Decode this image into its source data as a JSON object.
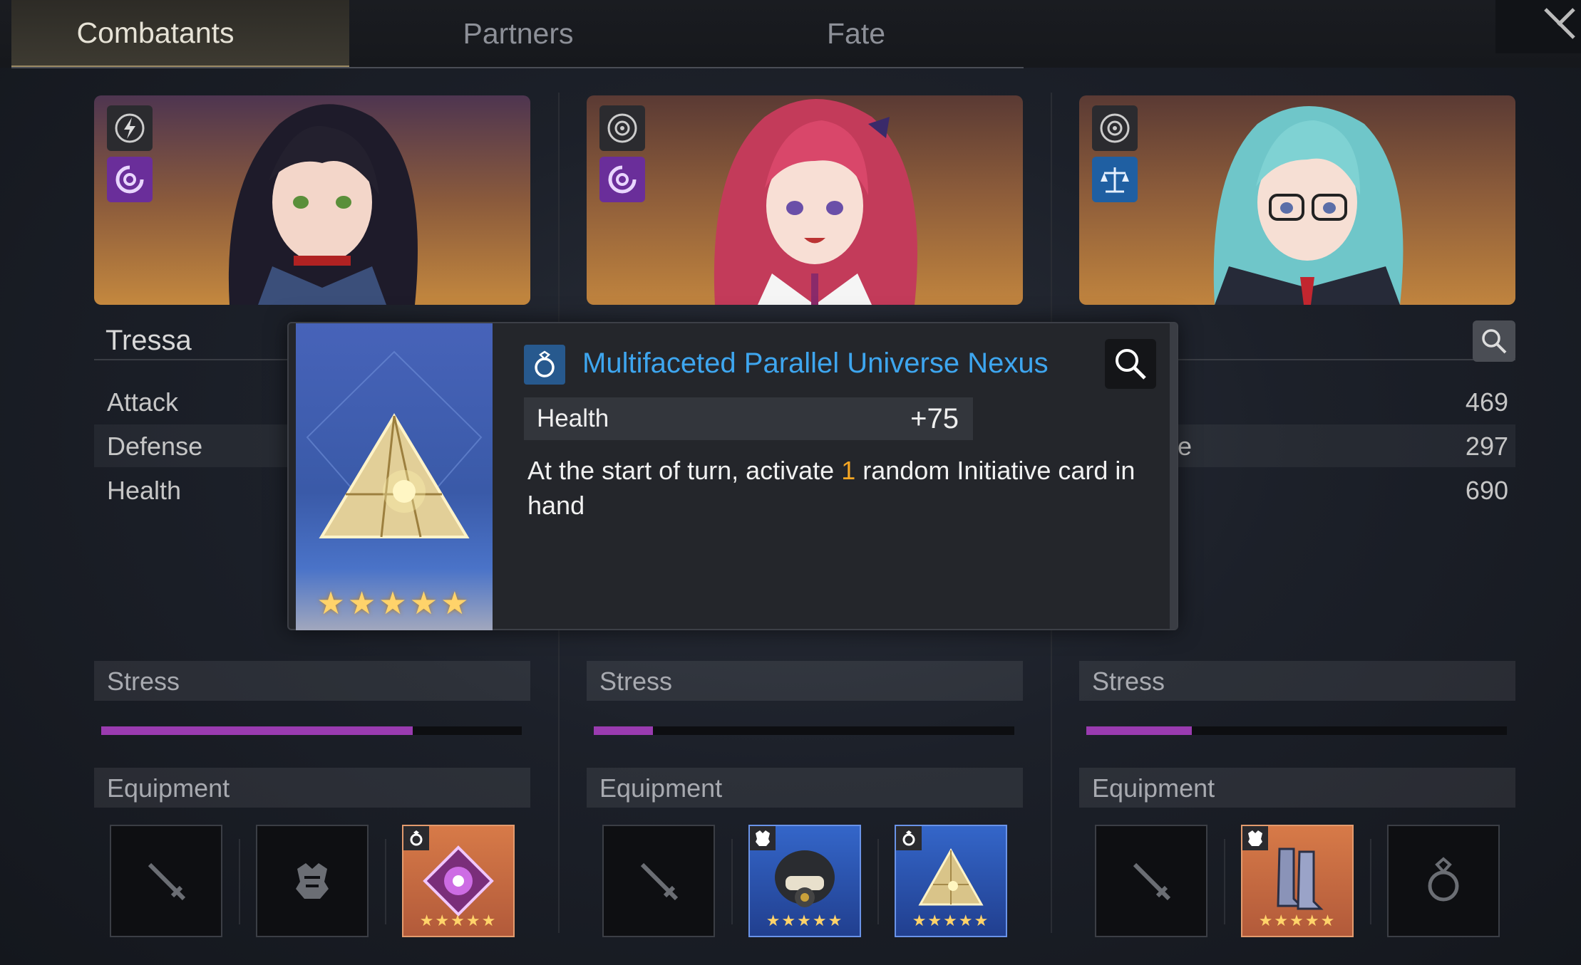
{
  "tabs": [
    {
      "label": "Combatants",
      "active": true
    },
    {
      "label": "Partners",
      "active": false
    },
    {
      "label": "Fate",
      "active": false
    }
  ],
  "characters": [
    {
      "name": "Tressa",
      "badges": [
        "lightning-icon",
        "swirl-icon"
      ],
      "stats": [
        {
          "label": "Attack",
          "value": ""
        },
        {
          "label": "Defense",
          "value": ""
        },
        {
          "label": "Health",
          "value": ""
        }
      ],
      "stress_label": "Stress",
      "stress_level": 0.74,
      "equipment_label": "Equipment",
      "equipment": [
        {
          "type": "weapon",
          "icon": "sword-icon",
          "filled": false
        },
        {
          "type": "armor",
          "icon": "armor-icon",
          "filled": false
        },
        {
          "type": "ring",
          "icon": "purple-crystal-item",
          "filled": true,
          "rarity": "★★★★★"
        }
      ]
    },
    {
      "name": "",
      "badges": [
        "target-icon",
        "swirl-icon"
      ],
      "stats": [
        {
          "label": "",
          "value": ""
        },
        {
          "label": "",
          "value": ""
        },
        {
          "label": "",
          "value": ""
        }
      ],
      "stress_label": "Stress",
      "stress_level": 0.14,
      "equipment_label": "Equipment",
      "equipment": [
        {
          "type": "weapon",
          "icon": "sword-icon",
          "filled": false
        },
        {
          "type": "armor",
          "icon": "gas-mask-helmet-item",
          "filled": true,
          "rarity": "★★★★★"
        },
        {
          "type": "ring",
          "icon": "pyramid-item",
          "filled": true,
          "rarity": "★★★★★"
        }
      ]
    },
    {
      "name": "",
      "badges": [
        "target-icon",
        "scales-icon"
      ],
      "stats": [
        {
          "label": "",
          "value": "469"
        },
        {
          "label": "se",
          "value": "297"
        },
        {
          "label": "",
          "value": "690"
        }
      ],
      "stress_label": "Stress",
      "stress_level": 0.25,
      "equipment_label": "Equipment",
      "equipment": [
        {
          "type": "weapon",
          "icon": "sword-icon",
          "filled": false
        },
        {
          "type": "armor",
          "icon": "boots-item",
          "filled": true,
          "rarity": "★★★★★"
        },
        {
          "type": "ring",
          "icon": "ring-icon",
          "filled": false
        }
      ]
    }
  ],
  "tooltip": {
    "title": "Multifaceted Parallel Universe Nexus",
    "type_icon": "ring-icon",
    "rarity": "★★★★★",
    "stat_label": "Health",
    "stat_value": "+75",
    "desc_before": "At the start of turn, activate ",
    "desc_highlight": "1",
    "desc_after": " random Initiative card in hand"
  },
  "colors": {
    "accent_title": "#3ea6ef",
    "highlight": "#f5a623",
    "stress": "#9a3bb0",
    "star": "#ffd36a"
  }
}
